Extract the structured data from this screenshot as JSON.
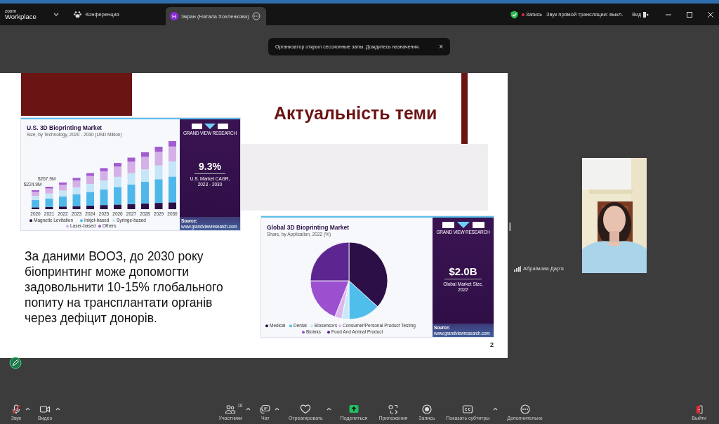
{
  "top_bar": {
    "logo_small": "zoom",
    "logo": "Workplace",
    "meeting_label": "Конференция",
    "tabs": [
      {
        "label": "Экран (Натала Хохленкова)",
        "avatar": "Н",
        "selected": true
      }
    ],
    "recording_label": "Запись",
    "stream_audio_status": "Звук прямой трансляции: выкл.",
    "view_label": "Вид"
  },
  "notification": {
    "text": "Организатор открыл сессионные залы. Дождитесь назначения.",
    "close": "×"
  },
  "slide": {
    "title": "Актуальність теми",
    "body": "За даними ВООЗ, до 2030 року біопринтинг може допомогти задовольнити 10-15% глобального попиту на трансплантати органів через дефіцит донорів.",
    "page_number": "2",
    "bar_chart": {
      "title": "U.S. 3D Bioprinting Market",
      "subtitle": "Size, by Technology, 2020 - 2030 (USD Million)",
      "years": [
        "2020",
        "2021",
        "2022",
        "2023",
        "2024",
        "2025",
        "2026",
        "2027",
        "2028",
        "2029",
        "2030"
      ],
      "callouts": [
        "$224.9M",
        "$267.9M"
      ],
      "legend": [
        {
          "label": "Magnetic Levitation",
          "color": "#2a0f45"
        },
        {
          "label": "Inkjet-based",
          "color": "#4fb8ea"
        },
        {
          "label": "Syringe-based",
          "color": "#c5e6f7"
        },
        {
          "label": "Laser-based",
          "color": "#d4b0e6"
        },
        {
          "label": "Others",
          "color": "#a25bd0"
        }
      ],
      "brand": "GRAND VIEW RESEARCH",
      "headline": "9.3%",
      "caption": [
        "U.S. Market CAGR,",
        "2023 - 2030"
      ],
      "source_label": "Source:",
      "source_url": "www.grandviewresearch.com"
    },
    "pie_chart": {
      "title": "Global 3D Bioprinting Market",
      "subtitle": "Share, by Application, 2022 (%)",
      "legend": [
        {
          "label": "Medical",
          "color": "#2d0f48"
        },
        {
          "label": "Dental",
          "color": "#4fbeea"
        },
        {
          "label": "Biosensors",
          "color": "#c8e8f8"
        },
        {
          "label": "Consumer/Personal Product Testing",
          "color": "#dcb8ee"
        },
        {
          "label": "Bioinks",
          "color": "#9b50d0"
        },
        {
          "label": "Food And Animal Product",
          "color": "#5c2590"
        }
      ],
      "brand": "GRAND VIEW RESEARCH",
      "headline": "$2.0B",
      "caption": [
        "Global Market Size,",
        "2022"
      ],
      "source_label": "Source:",
      "source_url": "www.grandviewresearch.com"
    }
  },
  "video": {
    "participant_name": "Абраімова Дар'я"
  },
  "toolbar": {
    "left": [
      {
        "kind": "mic",
        "label": "Звук",
        "muted": true,
        "caret": true
      },
      {
        "kind": "camera",
        "label": "Видео",
        "muted": false,
        "caret": true
      }
    ],
    "center": [
      {
        "kind": "participants",
        "label": "Участники",
        "count": "16",
        "muted": false,
        "caret": true
      },
      {
        "kind": "chat",
        "label": "Чат",
        "muted": false,
        "caret": true
      },
      {
        "kind": "react",
        "label": "Отреагировать",
        "muted": false,
        "caret": true
      },
      {
        "kind": "share",
        "label": "Поделиться",
        "muted": false,
        "caret": false
      },
      {
        "kind": "apps",
        "label": "Приложения",
        "muted": false,
        "caret": false
      },
      {
        "kind": "record",
        "label": "Запись",
        "muted": false,
        "caret": false
      },
      {
        "kind": "captions",
        "label": "Показать субтитры",
        "muted": false,
        "caret": true
      },
      {
        "kind": "more",
        "label": "Дополнительно",
        "muted": false,
        "caret": false
      }
    ],
    "right": [
      {
        "kind": "leave",
        "label": "Выйти",
        "muted": false,
        "caret": false
      }
    ]
  }
}
